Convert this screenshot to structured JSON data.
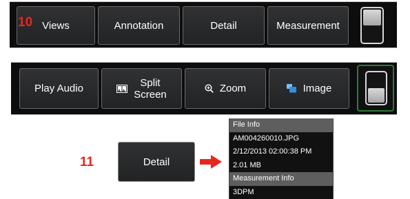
{
  "annotations": {
    "step_10": "10",
    "step_11": "11"
  },
  "toolbar_top": {
    "buttons": [
      "Views",
      "Annotation",
      "Detail",
      "Measurement"
    ]
  },
  "toolbar_bottom": {
    "play_audio": "Play Audio",
    "split_screen_line1": "Split",
    "split_screen_line2": "Screen",
    "zoom": "Zoom",
    "image": "Image"
  },
  "detail_button": {
    "label": "Detail"
  },
  "file_info_panel": {
    "rows": [
      {
        "text": "File Info",
        "header": true
      },
      {
        "text": "AM004260010.JPG",
        "header": false
      },
      {
        "text": "2/12/2013 02:00:38 PM",
        "header": false
      },
      {
        "text": "2.01 MB",
        "header": false
      },
      {
        "text": "Measurement Info",
        "header": true
      },
      {
        "text": "3DPM",
        "header": false
      }
    ]
  },
  "icons": {
    "split_screen": "split-screen-icon",
    "zoom": "zoom-icon",
    "image": "image-icon",
    "arrow": "arrow-right-icon"
  },
  "colors": {
    "accent_red": "#e8261f",
    "button_bg": "#2a2b2d",
    "panel_header": "#5e5e5e",
    "image_icon_blue": "#2f8fe0"
  }
}
